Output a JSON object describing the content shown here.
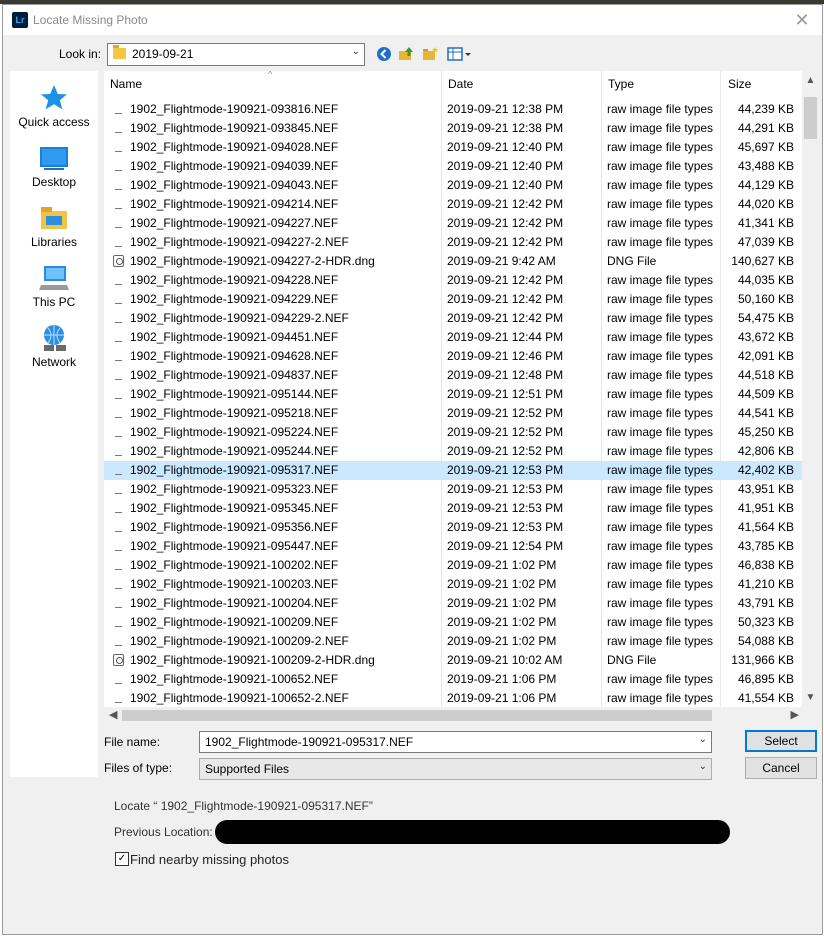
{
  "window": {
    "title": "Locate Missing Photo",
    "app_badge": "Lr"
  },
  "look_in": {
    "label": "Look in:",
    "value": "2019-09-21"
  },
  "places": [
    {
      "label": "Quick access",
      "icon": "quick-access-icon"
    },
    {
      "label": "Desktop",
      "icon": "desktop-icon"
    },
    {
      "label": "Libraries",
      "icon": "libraries-icon"
    },
    {
      "label": "This PC",
      "icon": "this-pc-icon"
    },
    {
      "label": "Network",
      "icon": "network-icon"
    }
  ],
  "columns": {
    "name": "Name",
    "date": "Date",
    "type": "Type",
    "size": "Size"
  },
  "files": [
    {
      "name": "1902_Flightmode-190921-093816.NEF",
      "date": "2019-09-21 12:38 PM",
      "type": "raw image file types",
      "size": "44,239 KB",
      "kind": "nef"
    },
    {
      "name": "1902_Flightmode-190921-093845.NEF",
      "date": "2019-09-21 12:38 PM",
      "type": "raw image file types",
      "size": "44,291 KB",
      "kind": "nef"
    },
    {
      "name": "1902_Flightmode-190921-094028.NEF",
      "date": "2019-09-21 12:40 PM",
      "type": "raw image file types",
      "size": "45,697 KB",
      "kind": "nef"
    },
    {
      "name": "1902_Flightmode-190921-094039.NEF",
      "date": "2019-09-21 12:40 PM",
      "type": "raw image file types",
      "size": "43,488 KB",
      "kind": "nef"
    },
    {
      "name": "1902_Flightmode-190921-094043.NEF",
      "date": "2019-09-21 12:40 PM",
      "type": "raw image file types",
      "size": "44,129 KB",
      "kind": "nef"
    },
    {
      "name": "1902_Flightmode-190921-094214.NEF",
      "date": "2019-09-21 12:42 PM",
      "type": "raw image file types",
      "size": "44,020 KB",
      "kind": "nef"
    },
    {
      "name": "1902_Flightmode-190921-094227.NEF",
      "date": "2019-09-21 12:42 PM",
      "type": "raw image file types",
      "size": "41,341 KB",
      "kind": "nef"
    },
    {
      "name": "1902_Flightmode-190921-094227-2.NEF",
      "date": "2019-09-21 12:42 PM",
      "type": "raw image file types",
      "size": "47,039 KB",
      "kind": "nef"
    },
    {
      "name": "1902_Flightmode-190921-094227-2-HDR.dng",
      "date": "2019-09-21 9:42 AM",
      "type": "DNG File",
      "size": "140,627 KB",
      "kind": "dng"
    },
    {
      "name": "1902_Flightmode-190921-094228.NEF",
      "date": "2019-09-21 12:42 PM",
      "type": "raw image file types",
      "size": "44,035 KB",
      "kind": "nef"
    },
    {
      "name": "1902_Flightmode-190921-094229.NEF",
      "date": "2019-09-21 12:42 PM",
      "type": "raw image file types",
      "size": "50,160 KB",
      "kind": "nef"
    },
    {
      "name": "1902_Flightmode-190921-094229-2.NEF",
      "date": "2019-09-21 12:42 PM",
      "type": "raw image file types",
      "size": "54,475 KB",
      "kind": "nef"
    },
    {
      "name": "1902_Flightmode-190921-094451.NEF",
      "date": "2019-09-21 12:44 PM",
      "type": "raw image file types",
      "size": "43,672 KB",
      "kind": "nef"
    },
    {
      "name": "1902_Flightmode-190921-094628.NEF",
      "date": "2019-09-21 12:46 PM",
      "type": "raw image file types",
      "size": "42,091 KB",
      "kind": "nef"
    },
    {
      "name": "1902_Flightmode-190921-094837.NEF",
      "date": "2019-09-21 12:48 PM",
      "type": "raw image file types",
      "size": "44,518 KB",
      "kind": "nef"
    },
    {
      "name": "1902_Flightmode-190921-095144.NEF",
      "date": "2019-09-21 12:51 PM",
      "type": "raw image file types",
      "size": "44,509 KB",
      "kind": "nef"
    },
    {
      "name": "1902_Flightmode-190921-095218.NEF",
      "date": "2019-09-21 12:52 PM",
      "type": "raw image file types",
      "size": "44,541 KB",
      "kind": "nef"
    },
    {
      "name": "1902_Flightmode-190921-095224.NEF",
      "date": "2019-09-21 12:52 PM",
      "type": "raw image file types",
      "size": "45,250 KB",
      "kind": "nef"
    },
    {
      "name": "1902_Flightmode-190921-095244.NEF",
      "date": "2019-09-21 12:52 PM",
      "type": "raw image file types",
      "size": "42,806 KB",
      "kind": "nef"
    },
    {
      "name": "1902_Flightmode-190921-095317.NEF",
      "date": "2019-09-21 12:53 PM",
      "type": "raw image file types",
      "size": "42,402 KB",
      "kind": "nef",
      "selected": true
    },
    {
      "name": "1902_Flightmode-190921-095323.NEF",
      "date": "2019-09-21 12:53 PM",
      "type": "raw image file types",
      "size": "43,951 KB",
      "kind": "nef"
    },
    {
      "name": "1902_Flightmode-190921-095345.NEF",
      "date": "2019-09-21 12:53 PM",
      "type": "raw image file types",
      "size": "41,951 KB",
      "kind": "nef"
    },
    {
      "name": "1902_Flightmode-190921-095356.NEF",
      "date": "2019-09-21 12:53 PM",
      "type": "raw image file types",
      "size": "41,564 KB",
      "kind": "nef"
    },
    {
      "name": "1902_Flightmode-190921-095447.NEF",
      "date": "2019-09-21 12:54 PM",
      "type": "raw image file types",
      "size": "43,785 KB",
      "kind": "nef"
    },
    {
      "name": "1902_Flightmode-190921-100202.NEF",
      "date": "2019-09-21 1:02 PM",
      "type": "raw image file types",
      "size": "46,838 KB",
      "kind": "nef"
    },
    {
      "name": "1902_Flightmode-190921-100203.NEF",
      "date": "2019-09-21 1:02 PM",
      "type": "raw image file types",
      "size": "41,210 KB",
      "kind": "nef"
    },
    {
      "name": "1902_Flightmode-190921-100204.NEF",
      "date": "2019-09-21 1:02 PM",
      "type": "raw image file types",
      "size": "43,791 KB",
      "kind": "nef"
    },
    {
      "name": "1902_Flightmode-190921-100209.NEF",
      "date": "2019-09-21 1:02 PM",
      "type": "raw image file types",
      "size": "50,323 KB",
      "kind": "nef"
    },
    {
      "name": "1902_Flightmode-190921-100209-2.NEF",
      "date": "2019-09-21 1:02 PM",
      "type": "raw image file types",
      "size": "54,088 KB",
      "kind": "nef"
    },
    {
      "name": "1902_Flightmode-190921-100209-2-HDR.dng",
      "date": "2019-09-21 10:02 AM",
      "type": "DNG File",
      "size": "131,966 KB",
      "kind": "dng"
    },
    {
      "name": "1902_Flightmode-190921-100652.NEF",
      "date": "2019-09-21 1:06 PM",
      "type": "raw image file types",
      "size": "46,895 KB",
      "kind": "nef"
    },
    {
      "name": "1902_Flightmode-190921-100652-2.NEF",
      "date": "2019-09-21 1:06 PM",
      "type": "raw image file types",
      "size": "41,554 KB",
      "kind": "nef"
    }
  ],
  "file_name": {
    "label": "File name:",
    "value": "1902_Flightmode-190921-095317.NEF"
  },
  "files_of_type": {
    "label": "Files of type:",
    "value": "Supported Files"
  },
  "buttons": {
    "select": "Select",
    "cancel": "Cancel"
  },
  "locate_text": "Locate “ 1902_Flightmode-190921-095317.NEF”",
  "previous_location_label": "Previous Location:",
  "find_nearby": {
    "label": "Find nearby missing photos",
    "checked": true
  }
}
